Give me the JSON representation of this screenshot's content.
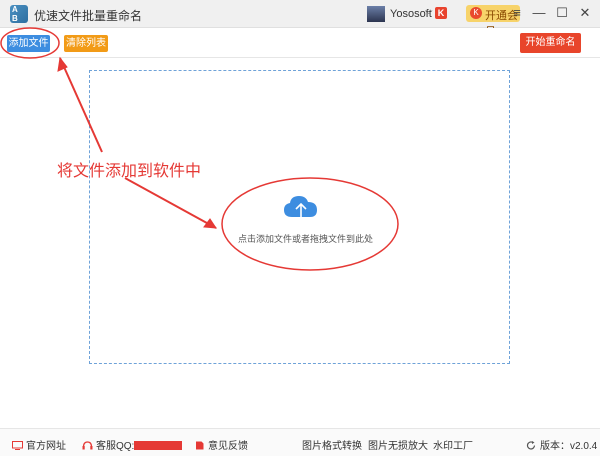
{
  "titlebar": {
    "icon_text": "A\nB",
    "title": "优速文件批量重命名",
    "username": "Yososoft",
    "chevron": "⌵",
    "brand_mark": "K",
    "vip_icon": "K",
    "vip_label": "开通会员",
    "window_controls": [
      "≡",
      "—",
      "☐",
      "✕"
    ]
  },
  "toolbar": {
    "add_label": "添加文件",
    "clear_label": "清除列表",
    "start_label": "开始重命名"
  },
  "dropzone": {
    "hint": "点击添加文件或者拖拽文件到此处",
    "icon": "cloud-upload-icon"
  },
  "annotation": {
    "label": "将文件添加到软件中"
  },
  "footer": {
    "website": "官方网址",
    "support": "客服QQ:",
    "feedback": "意见反馈",
    "format_convert": "图片格式转换",
    "lossless_zoom": "图片无损放大",
    "watermark": "水印工厂",
    "version": "版本：v2.0.4"
  },
  "colors": {
    "primary": "#3d8de0",
    "orange": "#f29b17",
    "danger": "#e8452b",
    "annotation_red": "#e53935"
  }
}
